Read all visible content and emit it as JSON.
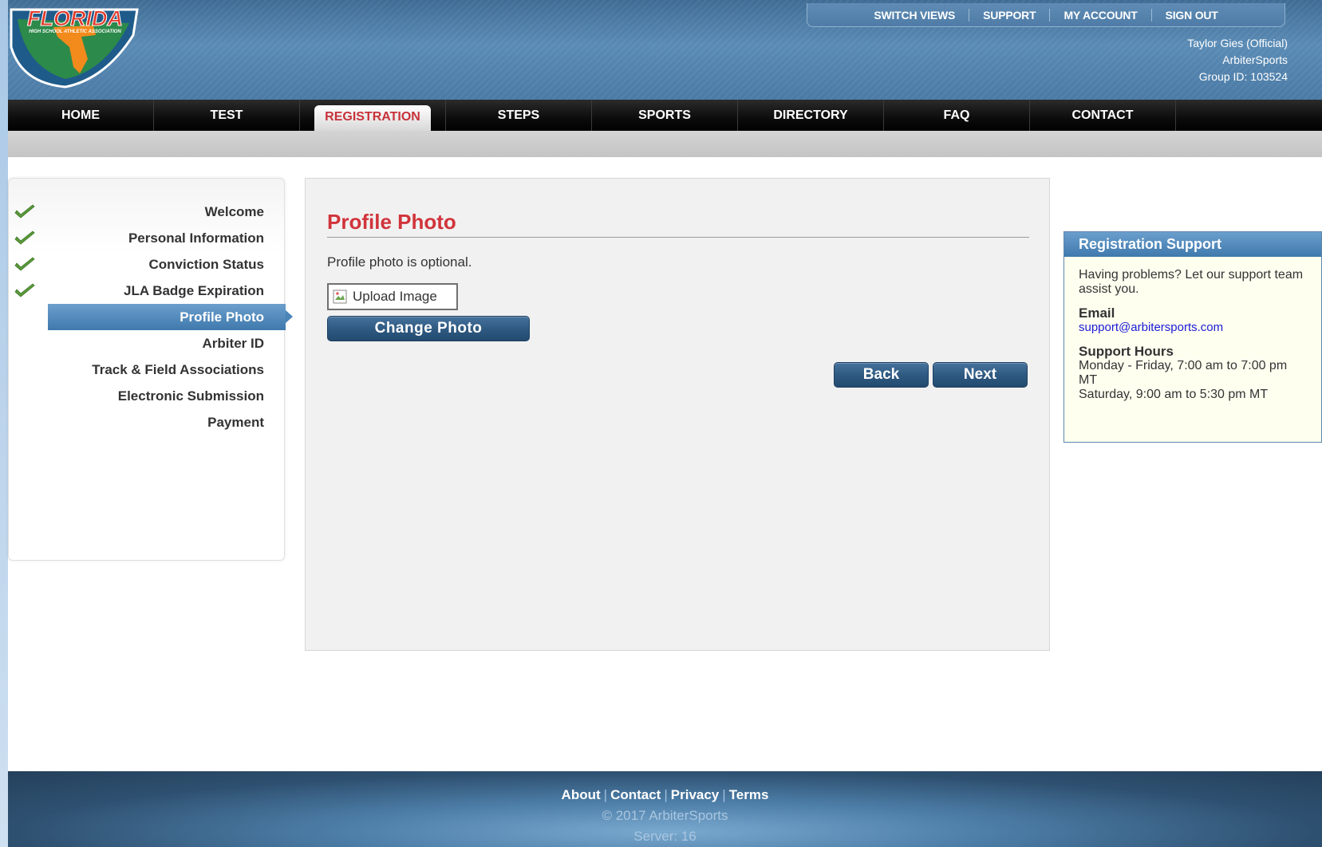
{
  "header": {
    "logo_text": "FLORIDA",
    "logo_subtext": "HIGH SCHOOL ATHLETIC ASSOCIATION",
    "utility_links": [
      "SWITCH VIEWS",
      "SUPPORT",
      "MY ACCOUNT",
      "SIGN OUT"
    ],
    "user": {
      "name": "Taylor Gies (Official)",
      "org": "ArbiterSports",
      "group": "Group ID: 103524"
    }
  },
  "nav": {
    "items": [
      "HOME",
      "TEST",
      "REGISTRATION",
      "STEPS",
      "SPORTS",
      "DIRECTORY",
      "FAQ",
      "CONTACT"
    ],
    "active": "REGISTRATION"
  },
  "steps": [
    {
      "label": "Welcome",
      "done": true
    },
    {
      "label": "Personal Information",
      "done": true
    },
    {
      "label": "Conviction Status",
      "done": true
    },
    {
      "label": "JLA Badge Expiration",
      "done": true
    },
    {
      "label": "Profile Photo",
      "active": true
    },
    {
      "label": "Arbiter ID"
    },
    {
      "label": "Track & Field Associations"
    },
    {
      "label": "Electronic Submission"
    },
    {
      "label": "Payment"
    }
  ],
  "main": {
    "title": "Profile Photo",
    "note": "Profile photo is optional.",
    "image_alt": "Upload Image",
    "change_photo_label": "Change Photo",
    "back_label": "Back",
    "next_label": "Next"
  },
  "support": {
    "title": "Registration Support",
    "intro": "Having problems? Let our support team assist you.",
    "email_label": "Email",
    "email": "support@arbitersports.com",
    "hours_label": "Support Hours",
    "hours_weekday": "Monday - Friday, 7:00 am to 7:00 pm MT",
    "hours_saturday": "Saturday, 9:00 am to 5:30 pm MT"
  },
  "footer": {
    "links": [
      "About",
      "Contact",
      "Privacy",
      "Terms"
    ],
    "copyright": "© 2017 ArbiterSports",
    "server": "Server: 16"
  },
  "colors": {
    "accent_red": "#d1343b",
    "nav_blue": "#4a7aa5",
    "button_blue": "#2f5a82",
    "check_green": "#5a9a3a",
    "link_blue": "#1a1ad6"
  }
}
